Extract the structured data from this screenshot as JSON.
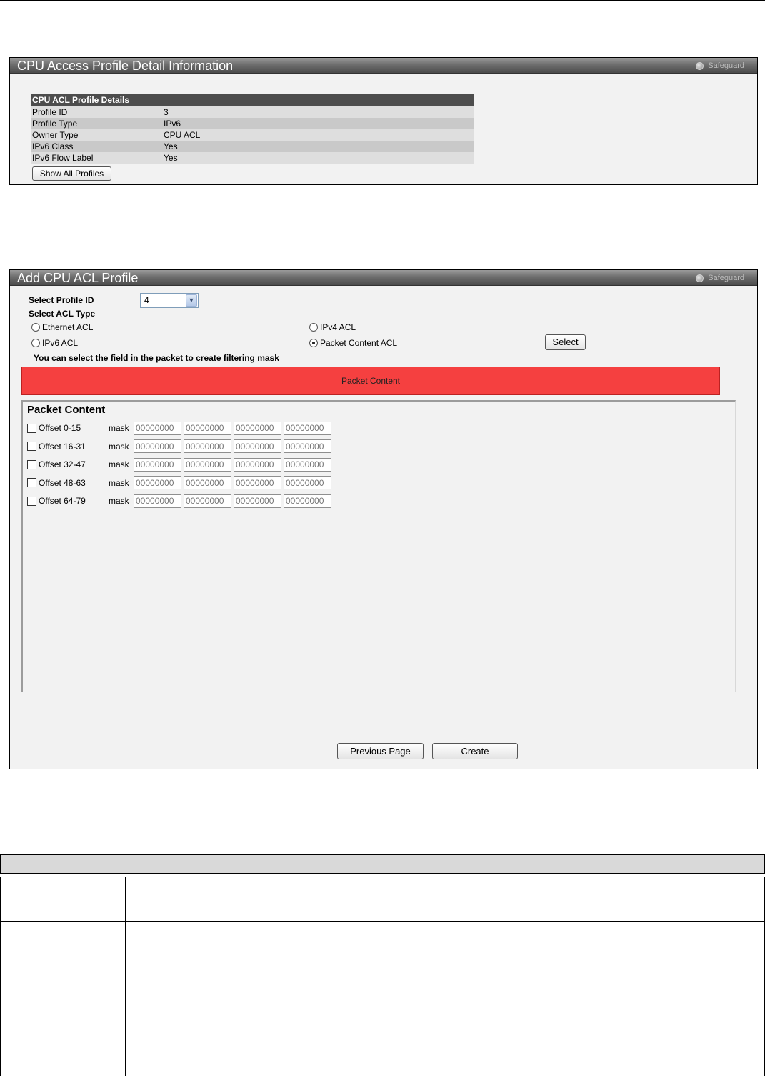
{
  "profile_details": {
    "window_title": "CPU Access Profile Detail Information",
    "safeguard": "Safeguard",
    "section_title": "CPU ACL Profile Details",
    "rows": [
      {
        "label": "Profile ID",
        "value": "3"
      },
      {
        "label": "Profile Type",
        "value": "IPv6"
      },
      {
        "label": "Owner Type",
        "value": "CPU ACL"
      },
      {
        "label": "IPv6 Class",
        "value": "Yes"
      },
      {
        "label": "IPv6 Flow Label",
        "value": "Yes"
      }
    ],
    "show_all_label": "Show All Profiles"
  },
  "add_profile": {
    "window_title": "Add CPU ACL Profile",
    "safeguard": "Safeguard",
    "profile_id_label": "Select Profile ID",
    "profile_id_value": "4",
    "acl_type_label": "Select ACL Type",
    "acl_types": [
      {
        "label": "Ethernet ACL",
        "selected": false
      },
      {
        "label": "IPv4 ACL",
        "selected": false
      },
      {
        "label": "IPv6 ACL",
        "selected": false
      },
      {
        "label": "Packet Content ACL",
        "selected": true
      }
    ],
    "select_button": "Select",
    "hint": "You can select the field in the packet to create filtering mask",
    "packet_bar": "Packet Content",
    "packet_title": "Packet Content",
    "mask_label": "mask",
    "offsets": [
      {
        "label": "Offset 0-15",
        "masks": [
          "00000000",
          "00000000",
          "00000000",
          "00000000"
        ]
      },
      {
        "label": "Offset 16-31",
        "masks": [
          "00000000",
          "00000000",
          "00000000",
          "00000000"
        ]
      },
      {
        "label": "Offset 32-47",
        "masks": [
          "00000000",
          "00000000",
          "00000000",
          "00000000"
        ]
      },
      {
        "label": "Offset 48-63",
        "masks": [
          "00000000",
          "00000000",
          "00000000",
          "00000000"
        ]
      },
      {
        "label": "Offset 64-79",
        "masks": [
          "00000000",
          "00000000",
          "00000000",
          "00000000"
        ]
      }
    ],
    "previous_button": "Previous Page",
    "create_button": "Create"
  },
  "colors": {
    "title_bar": "#5a5a5a",
    "packet_bar": "#f54040",
    "panel_bg": "#f2f2f2"
  }
}
